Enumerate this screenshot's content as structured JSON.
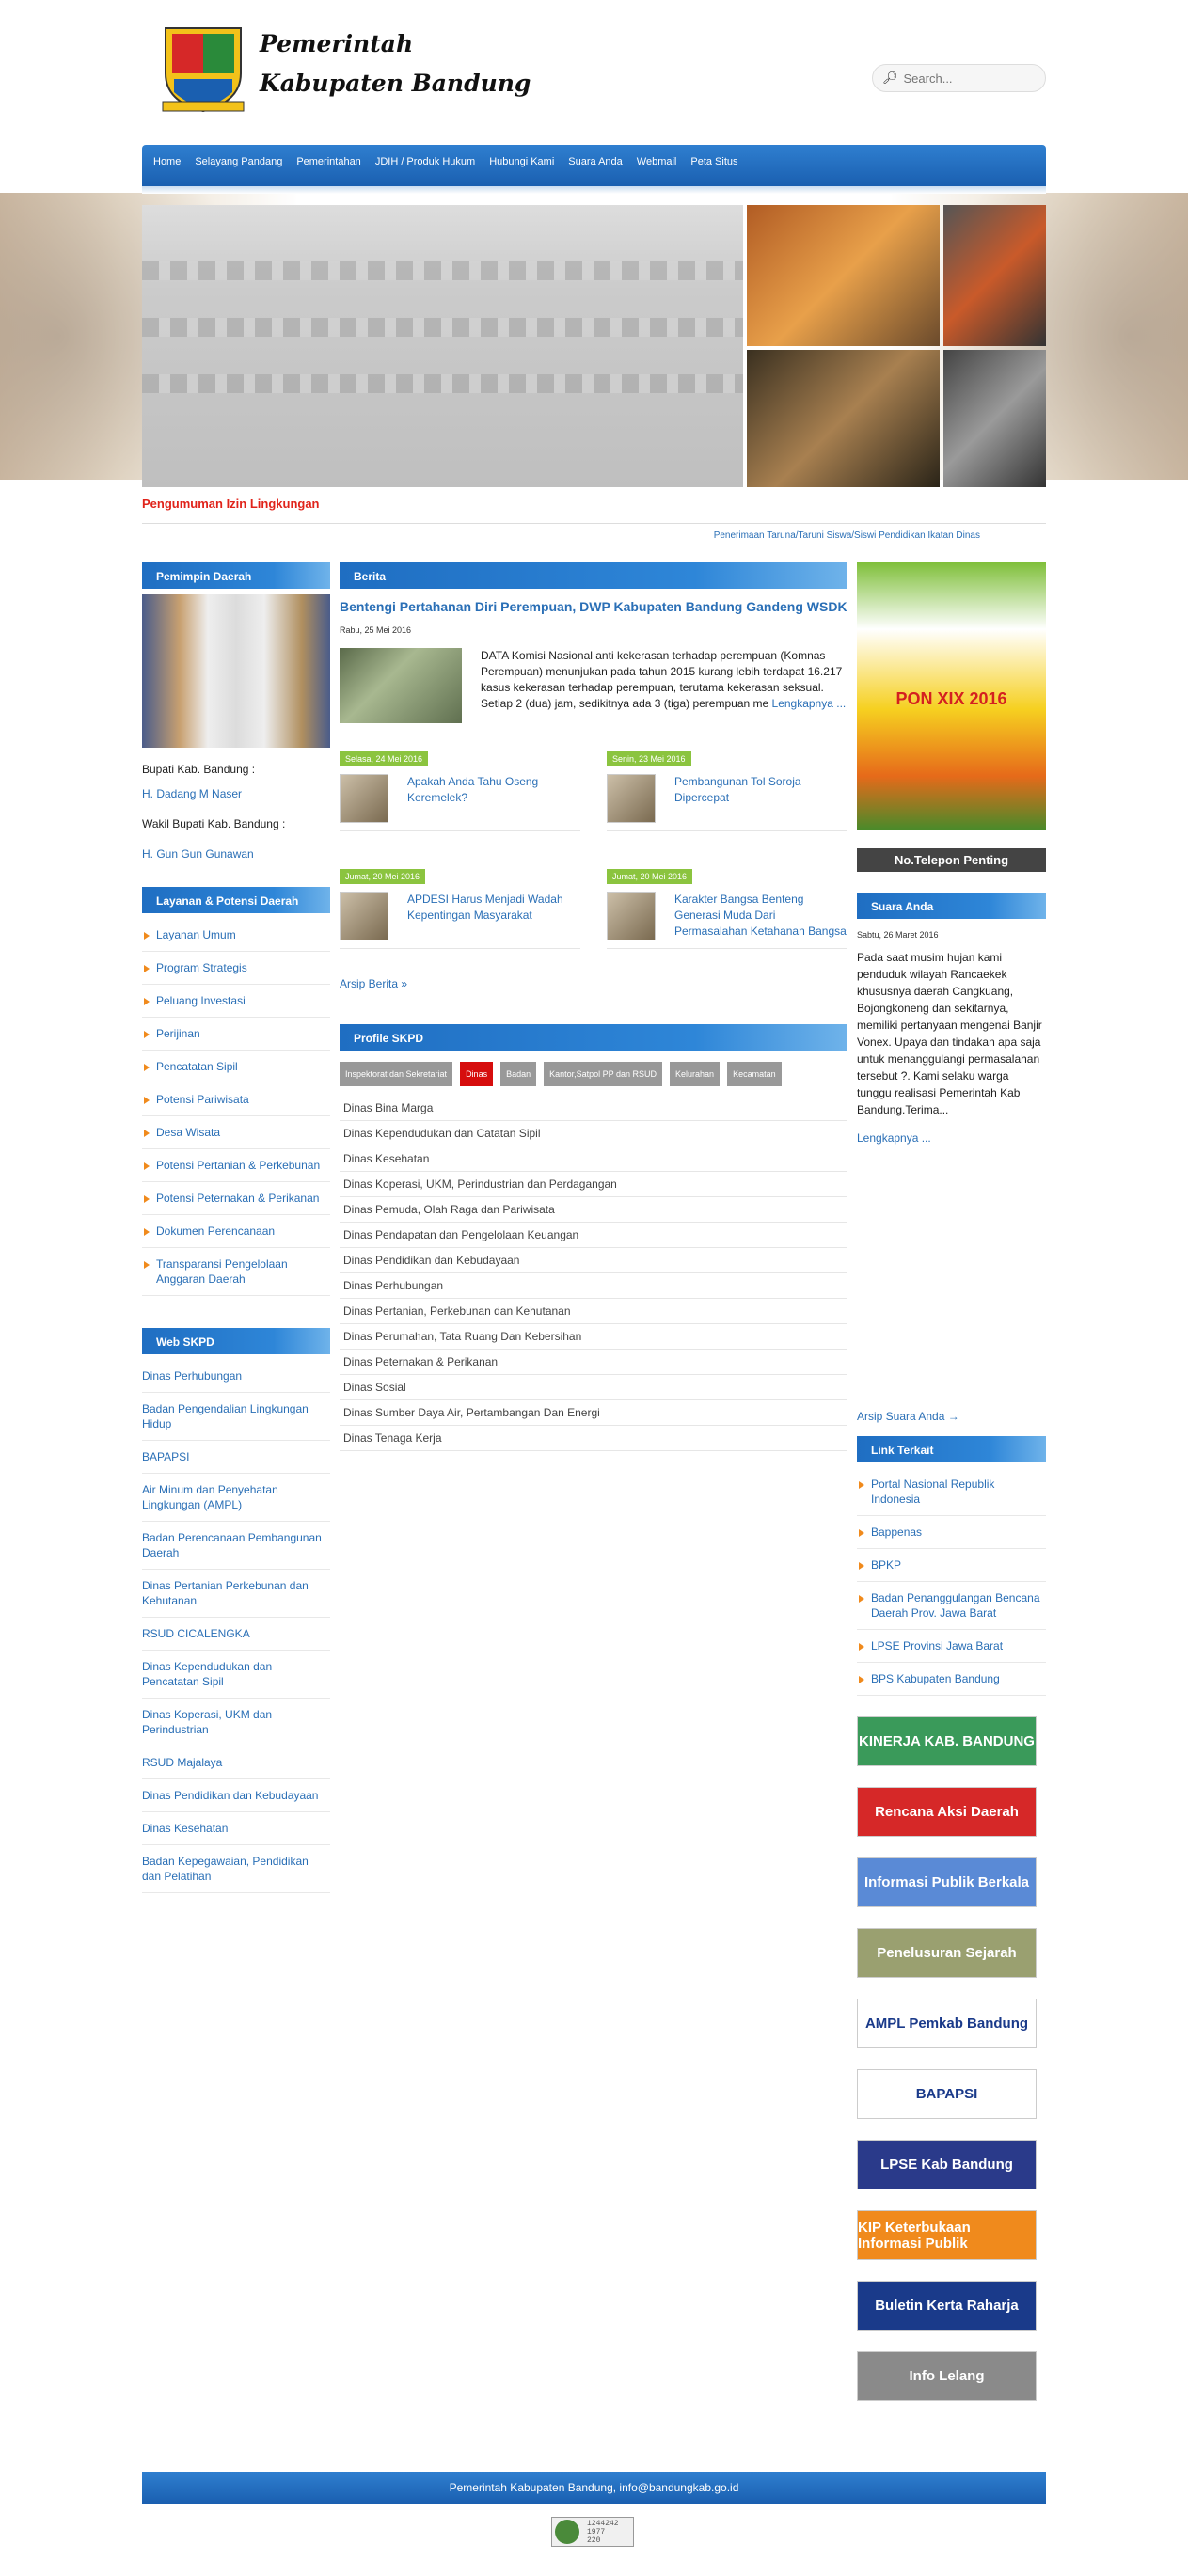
{
  "header": {
    "title_line1": "Pemerintah",
    "title_line2": "Kabupaten Bandung",
    "search_placeholder": "Search..."
  },
  "nav": [
    "Home",
    "Selayang Pandang",
    "Pemerintahan",
    "JDIH / Produk Hukum",
    "Hubungi Kami",
    "Suara Anda",
    "Webmail",
    "Peta Situs"
  ],
  "announcement": "Pengumuman Izin Lingkungan",
  "ticker": "Penerimaan Taruna/Taruni Siswa/Siswi Pendidikan Ikatan Dinas",
  "left": {
    "pemimpin_title": "Pemimpin Daerah",
    "bupati_label": "Bupati Kab. Bandung :",
    "bupati_name": "H. Dadang M Naser",
    "wakil_label": "Wakil Bupati Kab. Bandung :",
    "wakil_name": "H. Gun Gun Gunawan",
    "layanan_title": "Layanan & Potensi Daerah",
    "layanan": [
      "Layanan Umum",
      "Program Strategis",
      "Peluang Investasi",
      "Perijinan",
      "Pencatatan Sipil",
      "Potensi Pariwisata",
      "Desa Wisata",
      "Potensi Pertanian & Perkebunan",
      "Potensi Peternakan & Perikanan",
      "Dokumen Perencanaan",
      "Transparansi Pengelolaan Anggaran Daerah"
    ],
    "web_title": "Web SKPD",
    "web": [
      "Dinas Perhubungan",
      "Badan Pengendalian Lingkungan Hidup",
      "BAPAPSI",
      "Air Minum dan Penyehatan Lingkungan (AMPL)",
      "Badan Perencanaan Pembangunan Daerah",
      "Dinas Pertanian Perkebunan dan Kehutanan",
      "RSUD CICALENGKA",
      "Dinas Kependudukan dan Pencatatan Sipil",
      "Dinas Koperasi, UKM dan Perindustrian",
      "RSUD Majalaya",
      "Dinas Pendidikan dan Kebudayaan",
      "Dinas Kesehatan",
      "Badan Kepegawaian, Pendidikan dan Pelatihan"
    ]
  },
  "berita": {
    "title": "Berita",
    "headline": "Bentengi Pertahanan Diri Perempuan, DWP Kabupaten Bandung Gandeng WSDK",
    "date": "Rabu, 25 Mei 2016",
    "excerpt": "DATA Komisi Nasional anti kekerasan terhadap perempuan (Komnas Perempuan) menunjukan pada tahun 2015 kurang lebih terdapat 16.217 kasus kekerasan terhadap perempuan, terutama kekerasan seksual. Setiap 2 (dua) jam, sedikitnya ada 3 (tiga) perempuan me",
    "more": "Lengkapnya ...",
    "items": [
      {
        "date": "Selasa, 24 Mei 2016",
        "title": "Apakah Anda Tahu Oseng Keremelek?"
      },
      {
        "date": "Senin, 23 Mei 2016",
        "title": "Pembangunan Tol Soroja Dipercepat"
      },
      {
        "date": "Jumat, 20 Mei 2016",
        "title": "APDESI Harus Menjadi Wadah Kepentingan Masyarakat"
      },
      {
        "date": "Jumat, 20 Mei 2016",
        "title": "Karakter Bangsa Benteng Generasi Muda Dari Permasalahan Ketahanan Bangsa"
      }
    ],
    "archive": "Arsip Berita »"
  },
  "skpd": {
    "title": "Profile SKPD",
    "tabs": [
      "Inspektorat dan Sekretariat",
      "Dinas",
      "Badan",
      "Kantor,Satpol PP dan RSUD",
      "Kelurahan",
      "Kecamatan"
    ],
    "list": [
      "Dinas Bina Marga",
      "Dinas Kependudukan dan Catatan Sipil",
      "Dinas Kesehatan",
      "Dinas Koperasi, UKM, Perindustrian dan Perdagangan",
      "Dinas Pemuda, Olah Raga dan Pariwisata",
      "Dinas Pendapatan dan Pengelolaan Keuangan",
      "Dinas Pendidikan dan Kebudayaan",
      "Dinas Perhubungan",
      "Dinas Pertanian, Perkebunan dan Kehutanan",
      "Dinas Perumahan, Tata Ruang Dan Kebersihan",
      "Dinas Peternakan & Perikanan",
      "Dinas Sosial",
      "Dinas Sumber Daya Air, Pertambangan Dan Energi",
      "Dinas Tenaga Kerja"
    ]
  },
  "right": {
    "poster_text": "PON XIX 2016",
    "telepon": "No.Telepon Penting",
    "suara_title": "Suara Anda",
    "suara_date": "Sabtu, 26 Maret 2016",
    "suara_text": "Pada saat musim hujan kami penduduk wilayah Rancaekek khususnya daerah Cangkuang, Bojongkoneng dan sekitarnya, memiliki pertanyaan mengenai Banjir Vonex. Upaya dan tindakan apa saja untuk menanggulangi permasalahan tersebut ?. Kami selaku warga tunggu realisasi Pemerintah Kab Bandung.Terima...",
    "suara_more": "Lengkapnya ...",
    "suara_archive": "Arsip Suara Anda →",
    "link_title": "Link Terkait",
    "links": [
      "Portal Nasional Republik Indonesia",
      "Bappenas",
      "BPKP",
      "Badan Penanggulangan Bencana Daerah Prov. Jawa Barat",
      "LPSE Provinsi Jawa Barat",
      "BPS Kabupaten Bandung"
    ],
    "banners": [
      {
        "text": "KINERJA KAB. BANDUNG",
        "color": "#3a9a5a"
      },
      {
        "text": "Rencana Aksi Daerah",
        "color": "#d62828"
      },
      {
        "text": "Informasi Publik Berkala",
        "color": "#5a8ad6"
      },
      {
        "text": "Penelusuran Sejarah",
        "color": "#9aa070"
      },
      {
        "text": "AMPL Pemkab Bandung",
        "color": "#ffffff"
      },
      {
        "text": "BAPAPSI",
        "color": "#ffffff"
      },
      {
        "text": "LPSE Kab Bandung",
        "color": "#2a3a8a"
      },
      {
        "text": "KIP Keterbukaan Informasi Publik",
        "color": "#f08a1c"
      },
      {
        "text": "Buletin Kerta Raharja",
        "color": "#1a3a8a"
      },
      {
        "text": "Info Lelang",
        "color": "#8a8a8a"
      }
    ]
  },
  "footer": "Pemerintah Kabupaten Bandung, info@bandungkab.go.id",
  "counter": [
    "1244242",
    "1977",
    "220"
  ]
}
